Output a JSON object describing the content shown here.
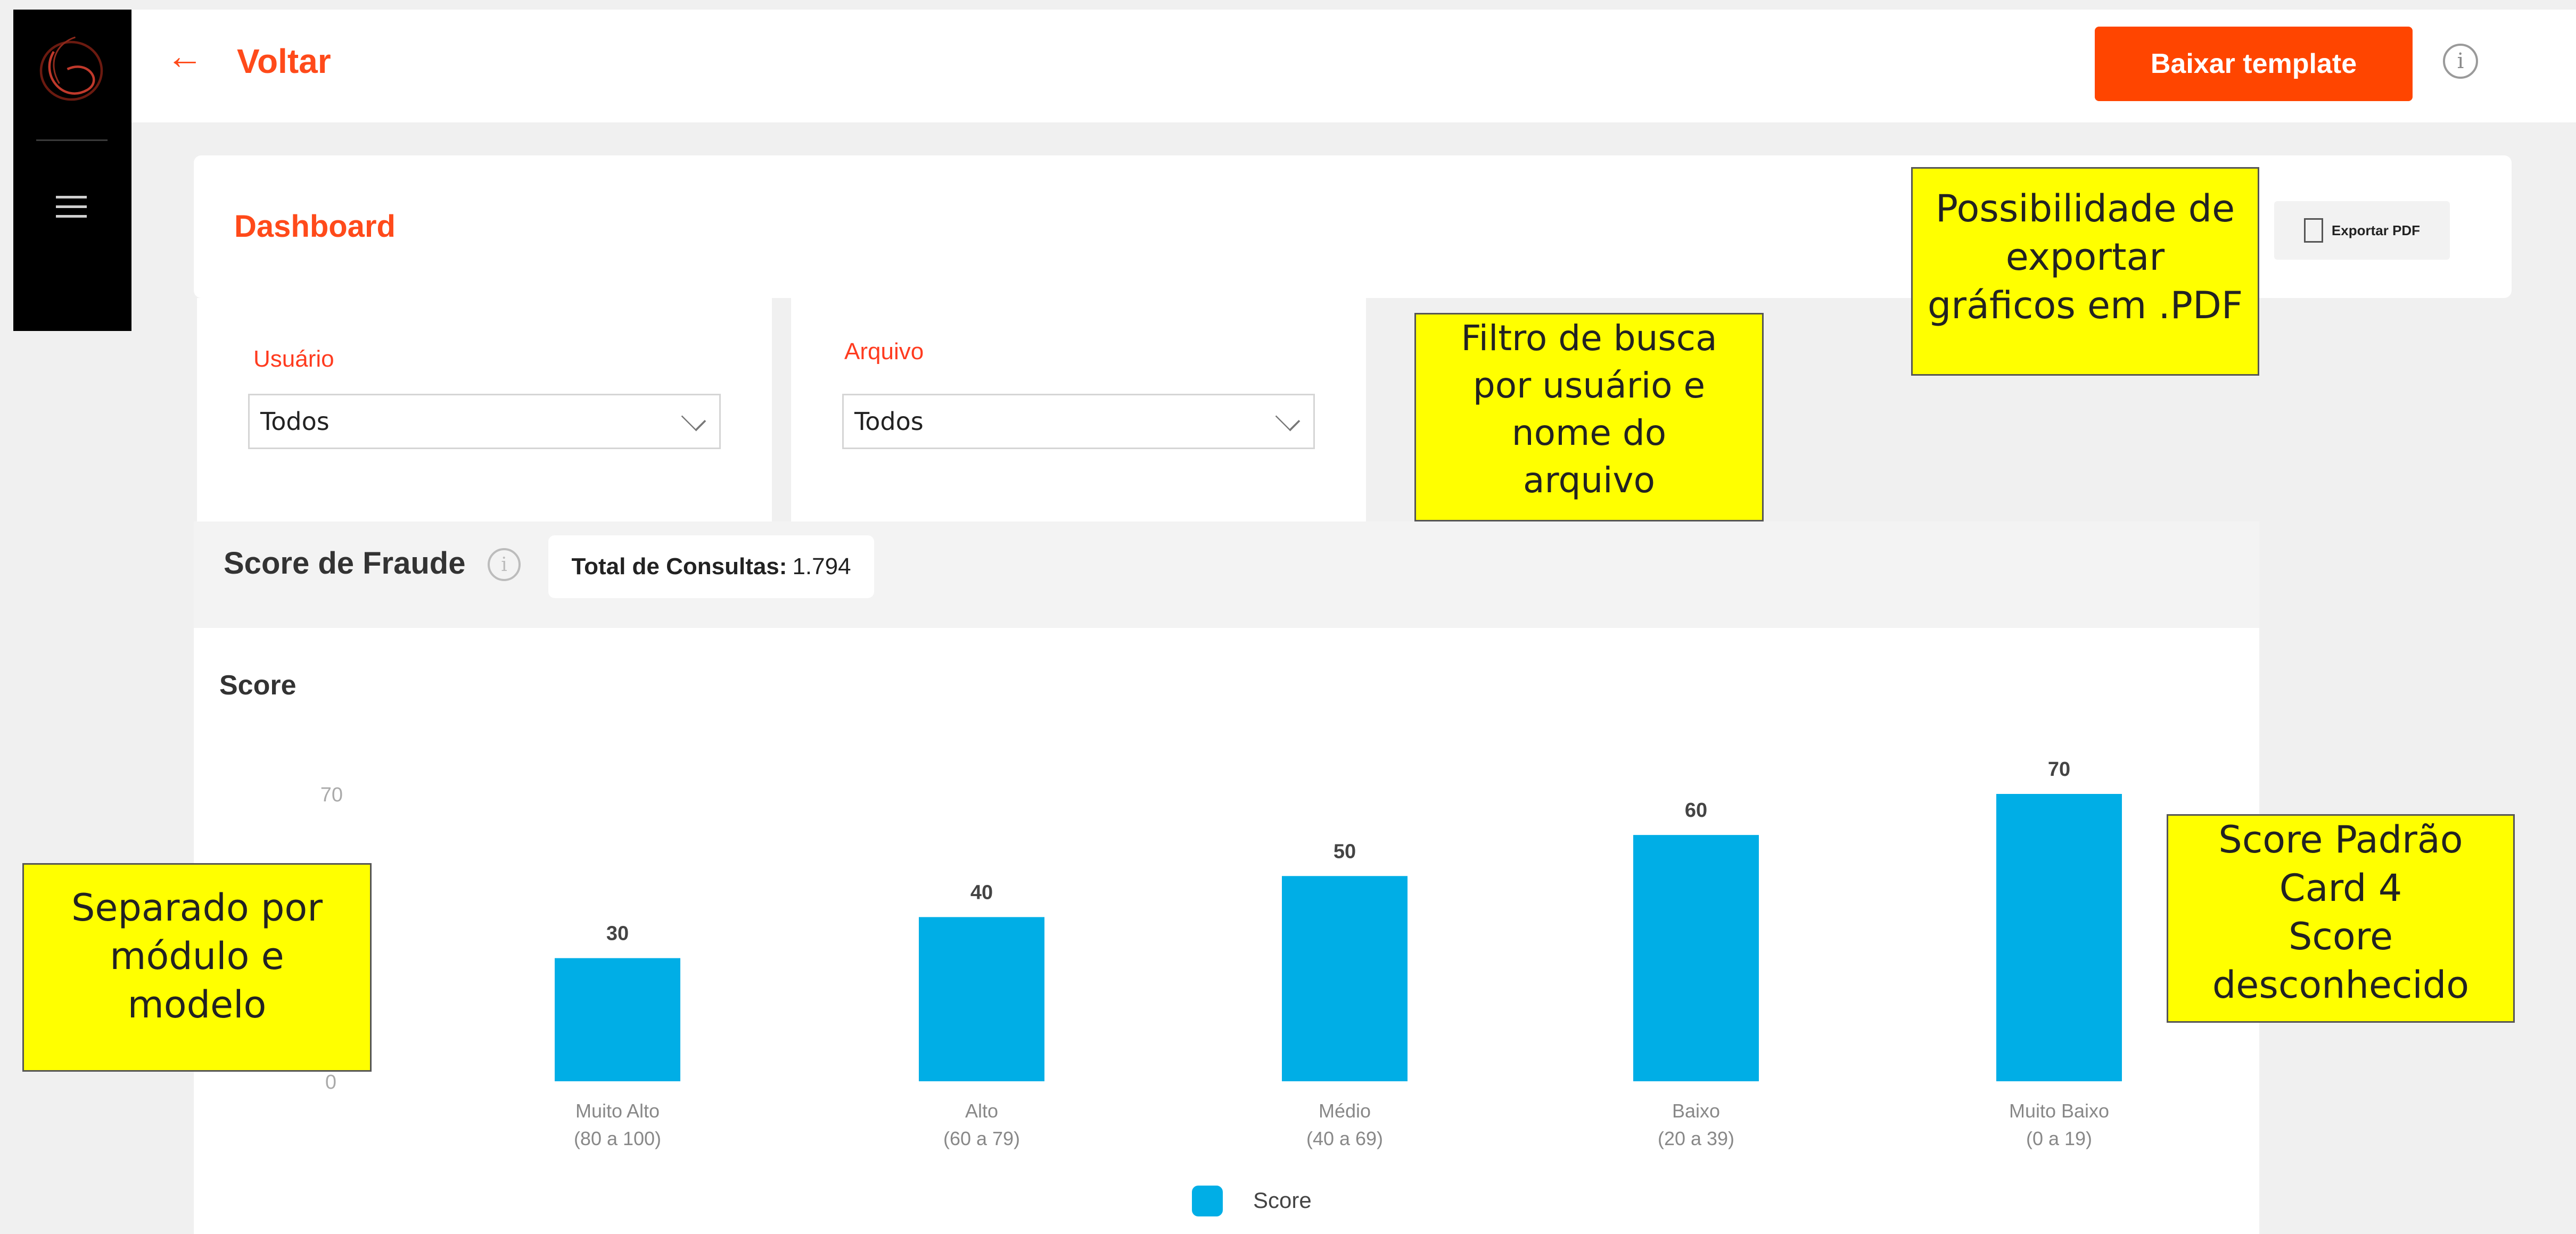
{
  "header": {
    "back_label": "Voltar",
    "download_button": "Baixar template"
  },
  "dashboard": {
    "title": "Dashboard",
    "export_label": "Exportar PDF"
  },
  "filters": {
    "usuario": {
      "label": "Usuário",
      "value": "Todos"
    },
    "arquivo": {
      "label": "Arquivo",
      "value": "Todos"
    }
  },
  "score_section": {
    "title": "Score de Fraude",
    "total_label": "Total de Consultas:",
    "total_value": "1.794"
  },
  "chart_data": {
    "type": "bar",
    "title": "Score",
    "categories": [
      [
        "Muito Alto",
        "(80 a 100)"
      ],
      [
        "Alto",
        "(60 a 79)"
      ],
      [
        "Médio",
        "(40 a 69)"
      ],
      [
        "Baixo",
        "(20 a 39)"
      ],
      [
        "Muito Baixo",
        "(0 a 19)"
      ]
    ],
    "series": [
      {
        "name": "Score",
        "values": [
          30,
          40,
          50,
          60,
          70
        ]
      }
    ],
    "ylim": [
      0,
      70
    ],
    "yticks": [
      "0",
      "70"
    ],
    "legend": "bottom-center",
    "bar_color": "#00aee6"
  },
  "notes": {
    "filter": [
      "Filtro de busca",
      "por usuário e",
      "nome do",
      "arquivo"
    ],
    "pdf": [
      "Possibilidade de",
      "exportar",
      "gráficos em .PDF"
    ],
    "module": [
      "Separado por",
      "módulo e",
      "modelo"
    ],
    "score": [
      "Score Padrão",
      "Card 4",
      "Score",
      "desconhecido"
    ]
  },
  "colors": {
    "accent": "#ff4500",
    "note": "#ffff00",
    "bar": "#00aee6"
  }
}
